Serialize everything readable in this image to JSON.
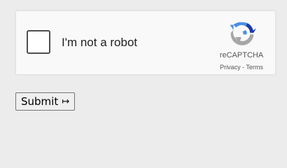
{
  "recaptcha": {
    "label": "I'm not a robot",
    "checked": false,
    "brand": "reCAPTCHA",
    "privacy": "Privacy",
    "separator": " - ",
    "terms": "Terms",
    "logo_icon": "recaptcha-logo-icon",
    "colors": {
      "logo_blue": "#4a90e2",
      "logo_dark_blue": "#1c3aa9",
      "logo_gray": "#a6a6a6"
    }
  },
  "form": {
    "submit_label": "Submit",
    "submit_icon": "↦"
  }
}
